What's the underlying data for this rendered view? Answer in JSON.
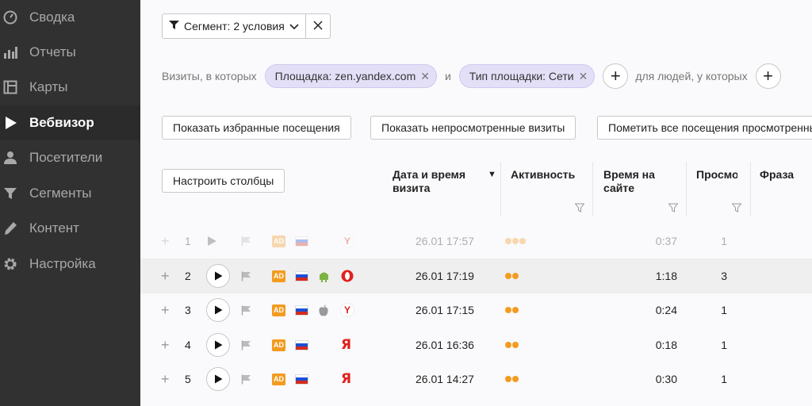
{
  "sidebar": {
    "items": [
      {
        "label": "Сводка",
        "icon": "gauge-icon"
      },
      {
        "label": "Отчеты",
        "icon": "bar-chart-icon"
      },
      {
        "label": "Карты",
        "icon": "map-icon"
      },
      {
        "label": "Вебвизор",
        "icon": "play-icon"
      },
      {
        "label": "Посетители",
        "icon": "person-icon"
      },
      {
        "label": "Сегменты",
        "icon": "funnel-icon"
      },
      {
        "label": "Контент",
        "icon": "pencil-icon"
      },
      {
        "label": "Настройка",
        "icon": "gear-icon"
      }
    ],
    "active": "Вебвизор"
  },
  "segment": {
    "label": "Сегмент: 2 условия"
  },
  "conditions": {
    "prefix": "Визиты, в которых",
    "pill1": "Площадка: zen.yandex.com",
    "and_word": "и",
    "pill2": "Тип площадки: Сети",
    "people_text": "для людей, у которых"
  },
  "actions": {
    "favorites": "Показать избранные посещения",
    "unwatched": "Показать непросмотренные визиты",
    "mark_all": "Пометить все посещения просмотренными"
  },
  "table": {
    "configure_columns": "Настроить столбцы",
    "columns": {
      "datetime_line1": "Дата и время",
      "datetime_line2": "визита",
      "activity": "Активность",
      "time_line1": "Время на",
      "time_line2": "сайте",
      "views": "Просмотры",
      "phrase": "Фраза"
    },
    "sort_indicator": "▼",
    "rows": [
      {
        "num": "1",
        "datetime": "26.01 17:57",
        "activity": 3,
        "duration": "0:37",
        "views": "1",
        "os": "",
        "browser": "yandex-icon",
        "browser_glyph": "Y",
        "faded": true
      },
      {
        "num": "2",
        "datetime": "26.01 17:19",
        "activity": 2,
        "duration": "1:18",
        "views": "3",
        "os": "android-icon",
        "browser": "opera-icon",
        "browser_glyph": "O",
        "faded": false
      },
      {
        "num": "3",
        "datetime": "26.01 17:15",
        "activity": 2,
        "duration": "0:24",
        "views": "1",
        "os": "apple-icon",
        "browser": "yandex-icon",
        "browser_glyph": "Y",
        "faded": false
      },
      {
        "num": "4",
        "datetime": "26.01 16:36",
        "activity": 2,
        "duration": "0:18",
        "views": "1",
        "os": "",
        "browser": "yandex-icon",
        "browser_glyph": "Я",
        "faded": false
      },
      {
        "num": "5",
        "datetime": "26.01 14:27",
        "activity": 2,
        "duration": "0:30",
        "views": "1",
        "os": "",
        "browser": "yandex-icon",
        "browser_glyph": "Я",
        "faded": false
      }
    ],
    "ad_badge": "AD"
  },
  "colors": {
    "sidebar_bg": "#313131",
    "pill_bg": "#e3dff7",
    "accent_orange": "#f39b20",
    "yandex_red": "#e0201c"
  }
}
